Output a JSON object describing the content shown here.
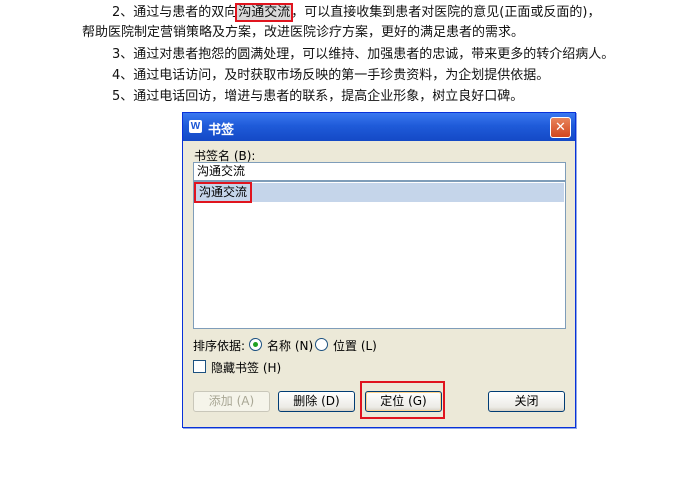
{
  "document": {
    "line1_pre": "2、通过与患者的双向",
    "line1_highlight": "沟通交流",
    "line1_post": "，可以直接收集到患者对医院的意见(正面或反面的)，",
    "line2": "帮助医院制定营销策略及方案，改进医院诊疗方案，更好的满足患者的需求。",
    "line3": "3、通过对患者抱怨的圆满处理，可以维持、加强患者的忠诚，带来更多的转介绍病人。",
    "line4": "4、通过电话访问，及时获取市场反映的第一手珍贵资料，为企划提供依据。",
    "line5": "5、通过电话回访，增进与患者的联系，提高企业形象，树立良好口碑。"
  },
  "dialog": {
    "icon_glyph": "W",
    "title": "书签",
    "close_glyph": "✕",
    "name_label": "书签名 (B):",
    "name_value": "沟通交流",
    "bookmarks": [
      "沟通交流"
    ],
    "sort_label": "排序依据:",
    "sort_options": [
      {
        "label": "名称 (N)",
        "checked": true
      },
      {
        "label": "位置 (L)",
        "checked": false
      }
    ],
    "hidden_label": "隐藏书签 (H)",
    "buttons": {
      "add": "添加 (A)",
      "delete": "删除 (D)",
      "goto": "定位 (G)",
      "close": "关闭"
    }
  },
  "colors": {
    "title_bar": "#1f5bd9",
    "highlight_frame": "#e0141e",
    "selection": "#c5d5ea"
  }
}
